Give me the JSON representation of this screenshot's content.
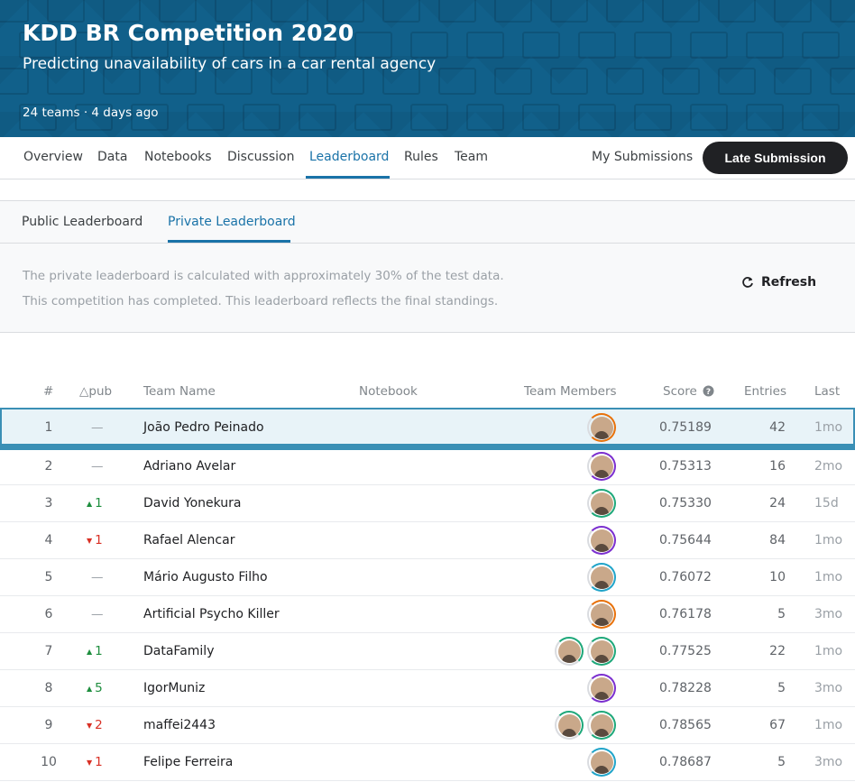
{
  "header": {
    "title": "KDD BR Competition 2020",
    "subtitle": "Predicting unavailability of cars in a car rental agency",
    "meta": "24 teams · 4 days ago"
  },
  "nav": {
    "tabs": [
      "Overview",
      "Data",
      "Notebooks",
      "Discussion",
      "Leaderboard",
      "Rules",
      "Team"
    ],
    "active": "Leaderboard",
    "my_submissions": "My Submissions",
    "late_submission": "Late Submission"
  },
  "leaderboard": {
    "tabs": [
      "Public Leaderboard",
      "Private Leaderboard"
    ],
    "active_tab": "Private Leaderboard",
    "info_line1": "The private leaderboard is calculated with approximately 30% of the test data.",
    "info_line2": "This competition has completed. This leaderboard reflects the final standings.",
    "refresh_label": "Refresh",
    "columns": {
      "rank": "#",
      "delta": "△pub",
      "team": "Team Name",
      "notebook": "Notebook",
      "members": "Team Members",
      "score": "Score",
      "entries": "Entries",
      "last": "Last"
    },
    "rows": [
      {
        "rank": "1",
        "delta": "—",
        "delta_dir": "none",
        "team": "João Pedro Peinado",
        "members": 1,
        "ring": "#e8710a",
        "score": "0.75189",
        "entries": "42",
        "last": "1mo"
      },
      {
        "rank": "2",
        "delta": "—",
        "delta_dir": "none",
        "team": "Adriano Avelar",
        "members": 1,
        "ring": "#7b2fcf",
        "score": "0.75313",
        "entries": "16",
        "last": "2mo"
      },
      {
        "rank": "3",
        "delta": "1",
        "delta_dir": "up",
        "team": "David Yonekura",
        "members": 1,
        "ring": "#1ea87a",
        "score": "0.75330",
        "entries": "24",
        "last": "15d"
      },
      {
        "rank": "4",
        "delta": "1",
        "delta_dir": "down",
        "team": "Rafael Alencar",
        "members": 1,
        "ring": "#7b2fcf",
        "score": "0.75644",
        "entries": "84",
        "last": "1mo"
      },
      {
        "rank": "5",
        "delta": "—",
        "delta_dir": "none",
        "team": "Mário Augusto Filho",
        "members": 1,
        "ring": "#20a4c9",
        "score": "0.76072",
        "entries": "10",
        "last": "1mo"
      },
      {
        "rank": "6",
        "delta": "—",
        "delta_dir": "none",
        "team": "Artificial Psycho Killer",
        "members": 1,
        "ring": "#e8710a",
        "score": "0.76178",
        "entries": "5",
        "last": "3mo"
      },
      {
        "rank": "7",
        "delta": "1",
        "delta_dir": "up",
        "team": "DataFamily",
        "members": 2,
        "ring": "#1ea87a",
        "score": "0.77525",
        "entries": "22",
        "last": "1mo"
      },
      {
        "rank": "8",
        "delta": "5",
        "delta_dir": "up",
        "team": "IgorMuniz",
        "members": 1,
        "ring": "#7b2fcf",
        "score": "0.78228",
        "entries": "5",
        "last": "3mo"
      },
      {
        "rank": "9",
        "delta": "2",
        "delta_dir": "down",
        "team": "maffei2443",
        "members": 2,
        "ring": "#1ea87a",
        "score": "0.78565",
        "entries": "67",
        "last": "1mo"
      },
      {
        "rank": "10",
        "delta": "1",
        "delta_dir": "down",
        "team": "Felipe Ferreira",
        "members": 1,
        "ring": "#20a4c9",
        "score": "0.78687",
        "entries": "5",
        "last": "3mo"
      }
    ]
  }
}
